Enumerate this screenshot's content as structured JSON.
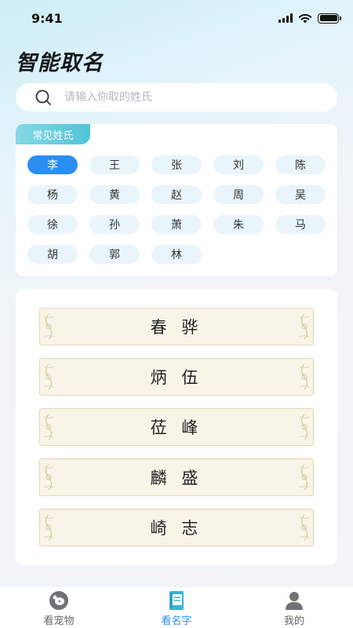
{
  "status_bar": {
    "time": "9:41",
    "battery_level": 1.0
  },
  "page_title": "智能取名",
  "search": {
    "placeholder": "请输入你取的姓氏",
    "value": ""
  },
  "surname_section": {
    "tag": "常见姓氏",
    "selected": "李",
    "surnames": [
      "李",
      "王",
      "张",
      "刘",
      "陈",
      "杨",
      "黄",
      "赵",
      "周",
      "吴",
      "徐",
      "孙",
      "萧",
      "朱",
      "马",
      "胡",
      "郭",
      "林"
    ]
  },
  "names": [
    "春 骅",
    "炳 伍",
    "莅 峰",
    "麟 盛",
    "崎 志"
  ],
  "tabs": [
    {
      "label": "看宠物",
      "icon": "pet-icon",
      "active": false
    },
    {
      "label": "看名字",
      "icon": "book-icon",
      "active": true
    },
    {
      "label": "我的",
      "icon": "profile-icon",
      "active": false
    }
  ],
  "colors": {
    "accent": "#2b8ef3",
    "tag_gradient_end": "#4fc3d8",
    "chip_bg": "#eaf4fb",
    "scroll_bg": "#f8f4e8"
  }
}
